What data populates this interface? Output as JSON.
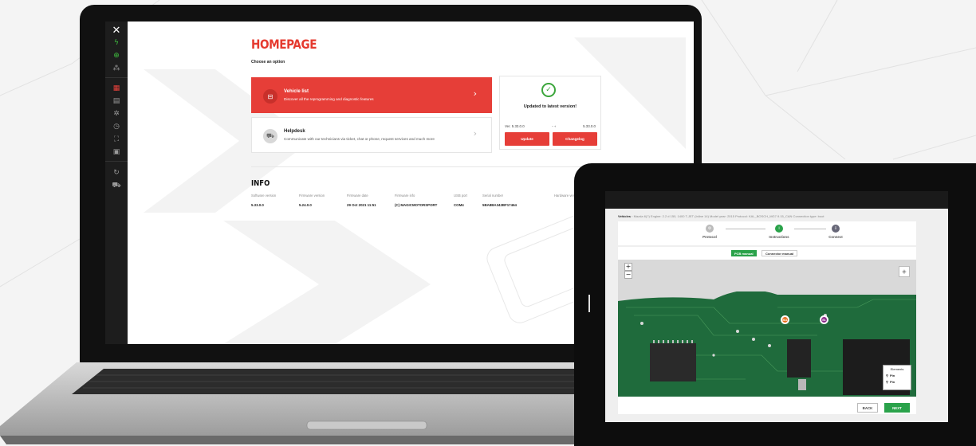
{
  "laptop": {
    "sidebar": {
      "logo": "✕",
      "icons": [
        "signal-icon",
        "globe-icon",
        "network-icon",
        "dashboard-icon",
        "database-icon",
        "gear-icon",
        "clock-icon",
        "expand-icon",
        "folder-icon",
        "refresh-icon",
        "car-icon"
      ]
    },
    "homepage": {
      "title": "HOMEPAGE",
      "subtitle": "Choose an option",
      "options": [
        {
          "title": "Vehicle list",
          "description": "Discover all the reprogramming and diagnostic features"
        },
        {
          "title": "Helpdesk",
          "description": "Communicate with our technicians via ticket, chat or phone, request services and much more"
        }
      ],
      "update": {
        "message": "Updated to latest version!",
        "current_version": "Ver. 5.33.0.0",
        "latest_version": "5.33.0.0",
        "update_label": "Update",
        "changelog_label": "Changelog"
      }
    },
    "info": {
      "title": "INFO",
      "columns": [
        {
          "label": "Software version",
          "value": "5.33.0.0"
        },
        {
          "label": "Firmware version",
          "value": "5.24.0.0"
        },
        {
          "label": "Firmware date",
          "value": "29 Oct 2021 11:51"
        },
        {
          "label": "Firmware info",
          "value": "(C) MAGICMOTORSPORT"
        },
        {
          "label": "USB port",
          "value": "COM4"
        },
        {
          "label": "Serial number",
          "value": "5BA8BA342BF17464"
        },
        {
          "label": "Hardware versi",
          "value": ""
        }
      ]
    }
  },
  "tablet": {
    "breadcrumb": {
      "root": "Vehicles",
      "path": "Mazda 6(?) Engine: 2.2 d 150, 1400 T-JET (Inline 14) Model year: 2015 Protocol: KAL_BOSCH_MG7.9.15_CAN Connection type: boot"
    },
    "steps": [
      {
        "label": "Protocol",
        "state": "done"
      },
      {
        "label": "Instructions",
        "state": "active"
      },
      {
        "label": "Connect",
        "state": "pending"
      }
    ],
    "tabs": [
      "PCB manual",
      "Connector manual"
    ],
    "map": {
      "zoom_in": "+",
      "zoom_out": "−",
      "pins": [
        "B11",
        "B1"
      ],
      "legend_title": "Elements",
      "legend_items": [
        "Pin",
        "Pin"
      ]
    },
    "buttons": {
      "back": "BACK",
      "next": "NEXT"
    }
  },
  "colors": {
    "brand_red": "#e63e38",
    "success_green": "#2aa24a",
    "sidebar_bg": "#1d1d1d"
  }
}
